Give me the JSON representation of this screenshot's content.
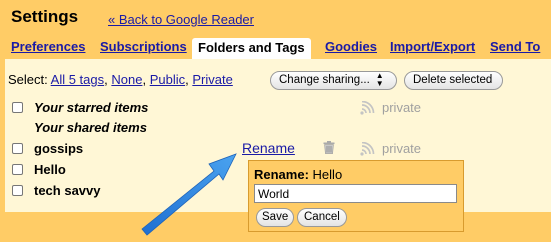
{
  "header": {
    "title": "Settings",
    "back_link": "« Back to Google Reader"
  },
  "tabs": [
    {
      "label": "Preferences",
      "active": false
    },
    {
      "label": "Subscriptions",
      "active": false
    },
    {
      "label": "Folders and Tags",
      "active": true
    },
    {
      "label": "Goodies",
      "active": false
    },
    {
      "label": "Import/Export",
      "active": false
    },
    {
      "label": "Send To",
      "active": false
    }
  ],
  "toolbar": {
    "select_label": "Select:",
    "select_all": "All 5 tags",
    "select_none": "None",
    "select_public": "Public",
    "select_private": "Private",
    "change_sharing": "Change sharing...",
    "delete_selected": "Delete selected"
  },
  "tags": [
    {
      "name": "Your starred items",
      "italic": true,
      "checkbox": true,
      "sharing": "private"
    },
    {
      "name": "Your shared items",
      "italic": true,
      "checkbox": false,
      "sharing": ""
    },
    {
      "name": "gossips",
      "italic": false,
      "checkbox": true,
      "sharing": "private"
    },
    {
      "name": "Hello",
      "italic": false,
      "checkbox": true,
      "sharing": ""
    },
    {
      "name": "tech savvy",
      "italic": false,
      "checkbox": true,
      "sharing": ""
    }
  ],
  "row_actions": {
    "rename_link": "Rename"
  },
  "rename_popup": {
    "label": "Rename:",
    "current_name": "Hello",
    "input_value": "World",
    "save": "Save",
    "cancel": "Cancel"
  },
  "colors": {
    "header_background": "#ffcc66",
    "panel_background": "#fff7d6",
    "link": "#1a1aa6",
    "annotation_arrow": "#2f8ae0"
  }
}
